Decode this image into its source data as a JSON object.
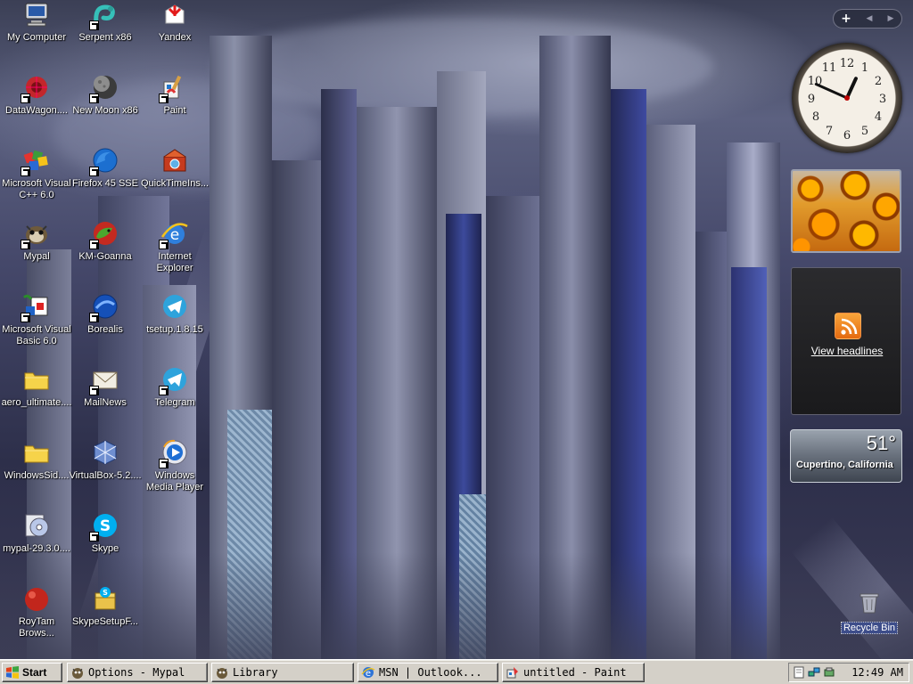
{
  "desktop": {
    "icons": [
      {
        "label": "My Computer",
        "icon": "my-computer-icon",
        "shortcut": false
      },
      {
        "label": "DataWagon....",
        "icon": "datawagon-icon",
        "shortcut": true
      },
      {
        "label": "Microsoft Visual\nC++ 6.0",
        "icon": "visual-cpp-icon",
        "shortcut": true
      },
      {
        "label": "Mypal",
        "icon": "mypal-icon",
        "shortcut": true
      },
      {
        "label": "Microsoft Visual\nBasic 6.0",
        "icon": "visual-basic-icon",
        "shortcut": true
      },
      {
        "label": "aero_ultimate....",
        "icon": "folder-icon",
        "shortcut": false
      },
      {
        "label": "WindowsSid....",
        "icon": "folder-icon",
        "shortcut": false
      },
      {
        "label": "mypal-29.3.0....",
        "icon": "installer-disc-icon",
        "shortcut": false
      },
      {
        "label": "RoyTam\nBrows...",
        "icon": "roytam-browser-icon",
        "shortcut": false
      },
      {
        "label": "Serpent x86",
        "icon": "serpent-icon",
        "shortcut": true
      },
      {
        "label": "New Moon x86",
        "icon": "new-moon-icon",
        "shortcut": true
      },
      {
        "label": "Firefox 45 SSE",
        "icon": "firefox-icon",
        "shortcut": true
      },
      {
        "label": "KM-Goanna",
        "icon": "km-goanna-icon",
        "shortcut": true
      },
      {
        "label": "Borealis",
        "icon": "borealis-icon",
        "shortcut": true
      },
      {
        "label": "MailNews",
        "icon": "mailnews-icon",
        "shortcut": true
      },
      {
        "label": "VirtualBox-5.2....",
        "icon": "virtualbox-icon",
        "shortcut": false
      },
      {
        "label": "Skype",
        "icon": "skype-icon",
        "shortcut": true
      },
      {
        "label": "SkypeSetupF...",
        "icon": "skype-setup-icon",
        "shortcut": false
      },
      {
        "label": "Yandex",
        "icon": "yandex-icon",
        "shortcut": false
      },
      {
        "label": "Paint",
        "icon": "paint-icon",
        "shortcut": true
      },
      {
        "label": "QuickTimeIns...",
        "icon": "quicktime-installer-icon",
        "shortcut": false
      },
      {
        "label": "Internet\nExplorer",
        "icon": "internet-explorer-icon",
        "shortcut": true
      },
      {
        "label": "tsetup.1.8.15",
        "icon": "telegram-setup-icon",
        "shortcut": false
      },
      {
        "label": "Telegram",
        "icon": "telegram-icon",
        "shortcut": true
      },
      {
        "label": "Windows\nMedia Player",
        "icon": "windows-media-player-icon",
        "shortcut": true
      }
    ],
    "recycle_bin": "Recycle Bin"
  },
  "sidebar": {
    "add_symbol": "+",
    "prev_symbol": "◀",
    "next_symbol": "▶",
    "clock": {
      "hour": 12,
      "minute": 49
    },
    "feed": {
      "link_text": "View headlines"
    },
    "weather": {
      "temperature": "51°",
      "location": "Cupertino, California"
    }
  },
  "taskbar": {
    "start_label": "Start",
    "tasks": [
      {
        "label": "Options - Mypal",
        "icon": "mypal-icon"
      },
      {
        "label": "Library",
        "icon": "mypal-icon"
      },
      {
        "label": "MSN | Outlook...",
        "icon": "internet-explorer-icon"
      },
      {
        "label": "untitled - Paint",
        "icon": "paint-icon"
      }
    ],
    "clock_text": "12:49 AM"
  }
}
